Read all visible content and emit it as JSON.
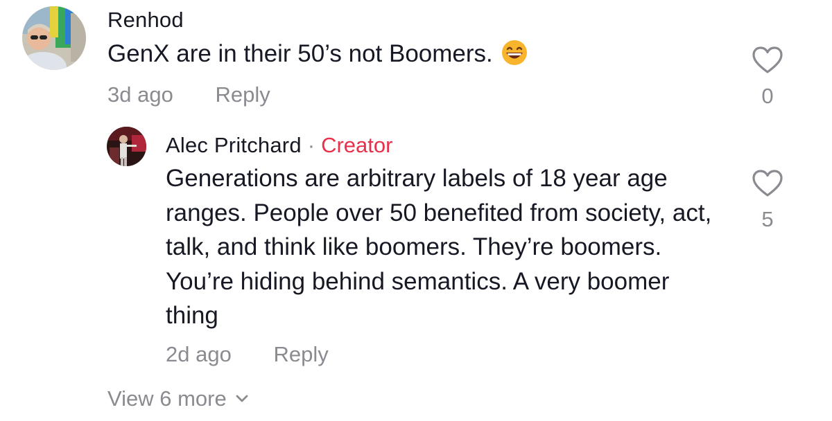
{
  "comments": [
    {
      "username": "Renhod",
      "text": "GenX are in their 50’s not Boomers.",
      "emoji_icon": "grinning-face-emoji",
      "time": "3d ago",
      "reply_label": "Reply",
      "likes": "0"
    }
  ],
  "reply": {
    "username": "Alec Pritchard",
    "separator": "·",
    "badge": "Creator",
    "text": "Generations are arbitrary labels of 18 year age ranges. People over 50 benefited from society, act, talk, and think like boomers. They’re boomers. You’re hiding behind semantics. A very boomer thing",
    "time": "2d ago",
    "reply_label": "Reply",
    "likes": "5"
  },
  "view_more": {
    "label": "View 6 more",
    "icon": "chevron-down-icon"
  },
  "colors": {
    "text": "#161823",
    "muted": "#8a8b91",
    "creator_badge": "#e8304b"
  }
}
